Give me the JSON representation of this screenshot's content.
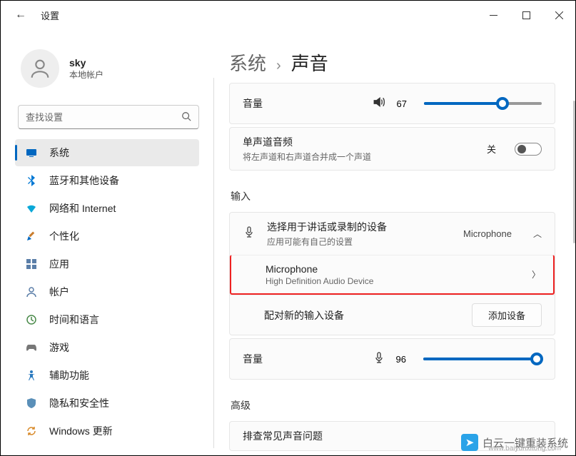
{
  "window": {
    "title": "设置"
  },
  "user": {
    "name": "sky",
    "sub": "本地帐户"
  },
  "search": {
    "placeholder": "查找设置"
  },
  "nav": {
    "system": "系统",
    "bluetooth": "蓝牙和其他设备",
    "network": "网络和 Internet",
    "personalize": "个性化",
    "apps": "应用",
    "accounts": "帐户",
    "time": "时间和语言",
    "gaming": "游戏",
    "accessibility": "辅助功能",
    "privacy": "隐私和安全性",
    "update": "Windows 更新"
  },
  "breadcrumb": {
    "parent": "系统",
    "sep": "›",
    "current": "声音"
  },
  "volume": {
    "label": "音量",
    "value": "67",
    "percent": 67
  },
  "mono": {
    "title": "单声道音频",
    "sub": "将左声道和右声道合并成一个声道",
    "state_label": "关"
  },
  "input_section": "输入",
  "input_device": {
    "title": "选择用于讲话或录制的设备",
    "sub": "应用可能有自己的设置",
    "value": "Microphone"
  },
  "mic_item": {
    "title": "Microphone",
    "sub": "High Definition Audio Device"
  },
  "pair": {
    "label": "配对新的输入设备",
    "btn": "添加设备"
  },
  "input_volume": {
    "label": "音量",
    "value": "96",
    "percent": 96
  },
  "advanced_section": "高级",
  "truncated_row": "排查常见声音问题",
  "watermark": {
    "text": "白云一键重装系统",
    "url": "www.baiyunxitong.com"
  }
}
